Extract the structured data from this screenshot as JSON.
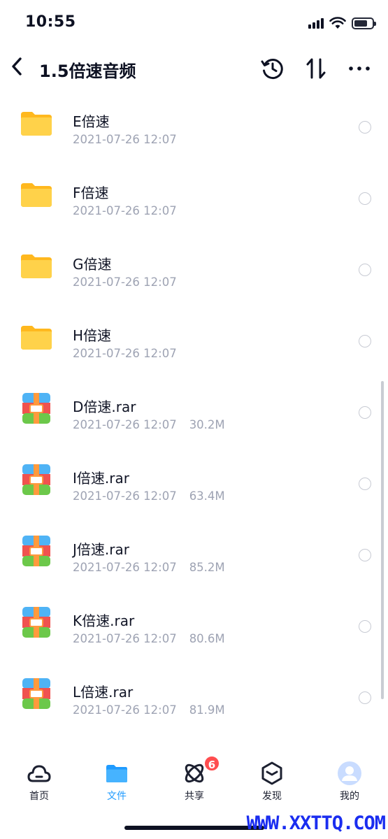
{
  "status_bar": {
    "time": "10:55"
  },
  "header": {
    "title": "1.5倍速音频"
  },
  "files": [
    {
      "type": "folder",
      "name": "E倍速",
      "date": "2021-07-26 12:07",
      "size": ""
    },
    {
      "type": "folder",
      "name": "F倍速",
      "date": "2021-07-26 12:07",
      "size": ""
    },
    {
      "type": "folder",
      "name": "G倍速",
      "date": "2021-07-26 12:07",
      "size": ""
    },
    {
      "type": "folder",
      "name": "H倍速",
      "date": "2021-07-26 12:07",
      "size": ""
    },
    {
      "type": "archive",
      "name": "D倍速.rar",
      "date": "2021-07-26 12:07",
      "size": "30.2M"
    },
    {
      "type": "archive",
      "name": "I倍速.rar",
      "date": "2021-07-26 12:07",
      "size": "63.4M"
    },
    {
      "type": "archive",
      "name": "J倍速.rar",
      "date": "2021-07-26 12:07",
      "size": "85.2M"
    },
    {
      "type": "archive",
      "name": "K倍速.rar",
      "date": "2021-07-26 12:07",
      "size": "80.6M"
    },
    {
      "type": "archive",
      "name": "L倍速.rar",
      "date": "2021-07-26 12:07",
      "size": "81.9M"
    }
  ],
  "tabs": [
    {
      "label": "首页",
      "icon": "cloud-icon",
      "active": false
    },
    {
      "label": "文件",
      "icon": "folder-icon",
      "active": true
    },
    {
      "label": "共享",
      "icon": "atom-icon",
      "active": false,
      "badge": "6"
    },
    {
      "label": "发现",
      "icon": "cube-icon",
      "active": false
    },
    {
      "label": "我的",
      "icon": "avatar-icon",
      "active": false
    }
  ],
  "colors": {
    "accent": "#1f9bff",
    "badge": "#ff4d4f",
    "folder": "#ffc933",
    "meta_text": "#9ea3b3"
  },
  "watermark": "WWW.XXTTQ.COM"
}
